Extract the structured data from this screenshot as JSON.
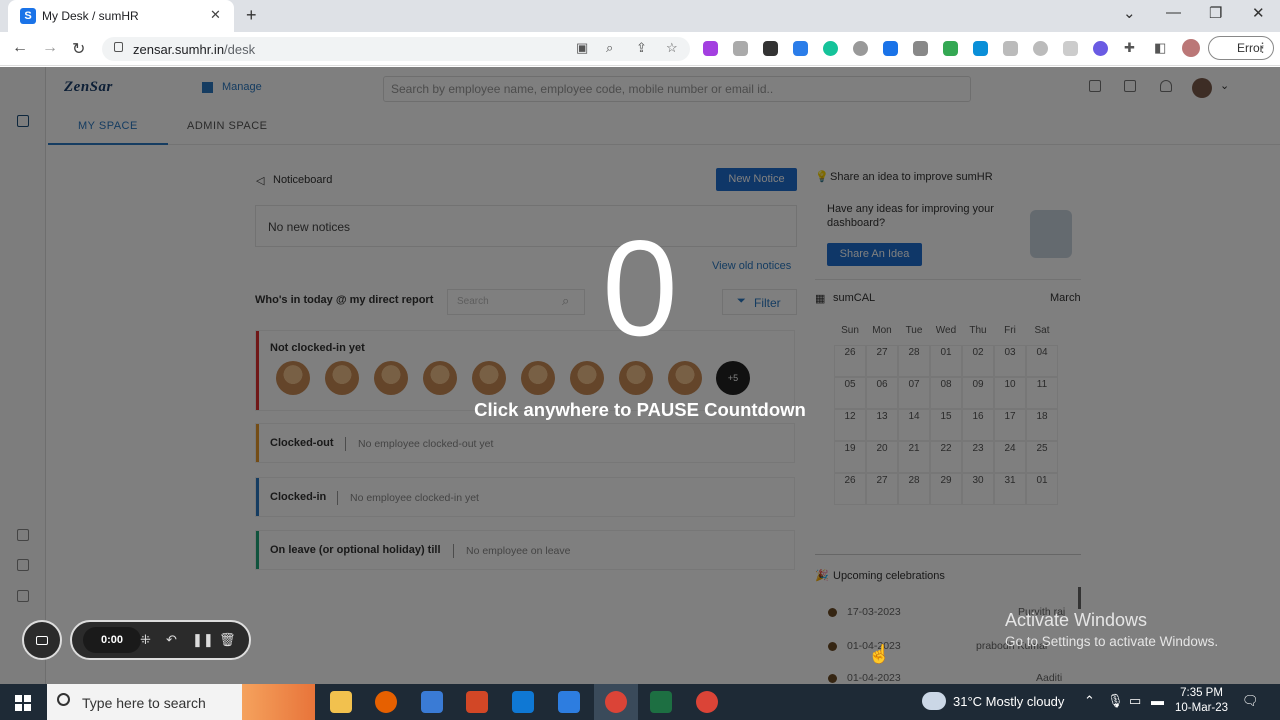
{
  "browser": {
    "tab_title": "My Desk / sumHR",
    "tab_favicon": "S",
    "url_host": "zensar.sumhr.in",
    "url_path": "/desk",
    "profile_button": "Error"
  },
  "app": {
    "logo": "ZenSar",
    "manage": "Manage",
    "search_placeholder": "Search by employee name, employee code, mobile number or email id..",
    "tabs": [
      "MY SPACE",
      "ADMIN SPACE"
    ]
  },
  "noticeboard": {
    "title": "Noticeboard",
    "new_button": "New Notice",
    "empty": "No new notices",
    "view_old": "View old notices"
  },
  "whos_in": {
    "title": "Who's in today @ my direct report",
    "search_placeholder": "Search",
    "filter": "Filter",
    "not_clocked_in": "Not clocked-in yet",
    "more_count": "+5",
    "clocked_out": {
      "label": "Clocked-out",
      "message": "No employee clocked-out yet"
    },
    "clocked_in": {
      "label": "Clocked-in",
      "message": "No employee clocked-in yet"
    },
    "on_leave": {
      "label": "On leave (or optional holiday) till",
      "message": "No employee on leave"
    }
  },
  "idea": {
    "title": "Share an idea to improve sumHR",
    "text": "Have any ideas for improving your dashboard?",
    "button": "Share An Idea"
  },
  "calendar": {
    "title": "sumCAL",
    "month": "March",
    "days": [
      "Sun",
      "Mon",
      "Tue",
      "Wed",
      "Thu",
      "Fri",
      "Sat"
    ],
    "weeks": [
      [
        "26",
        "27",
        "28",
        "01",
        "02",
        "03",
        "04"
      ],
      [
        "05",
        "06",
        "07",
        "08",
        "09",
        "10",
        "11"
      ],
      [
        "12",
        "13",
        "14",
        "15",
        "16",
        "17",
        "18"
      ],
      [
        "19",
        "20",
        "21",
        "22",
        "23",
        "24",
        "25"
      ],
      [
        "26",
        "27",
        "28",
        "29",
        "30",
        "31",
        "01"
      ]
    ]
  },
  "celebrations": {
    "title": "Upcoming celebrations",
    "items": [
      {
        "date": "17-03-2023",
        "name": "Purvith raj"
      },
      {
        "date": "01-04-2023",
        "name": "prabodh Kumar"
      },
      {
        "date": "01-04-2023",
        "name": "Aaditi"
      }
    ]
  },
  "overlay": {
    "countdown": "0",
    "message": "Click anywhere to PAUSE Countdown",
    "activate_title": "Activate Windows",
    "activate_sub": "Go to Settings to activate Windows."
  },
  "recorder": {
    "time": "0:00"
  },
  "taskbar": {
    "search_placeholder": "Type here to search",
    "weather": "31°C  Mostly cloudy",
    "time": "7:35 PM",
    "date": "10-Mar-23"
  },
  "colors": {
    "accent": "#1f6fd0",
    "red_bar": "#e03030",
    "orange_bar": "#e89a2c",
    "blue_bar": "#2a78c2",
    "green_bar": "#21a67a"
  }
}
